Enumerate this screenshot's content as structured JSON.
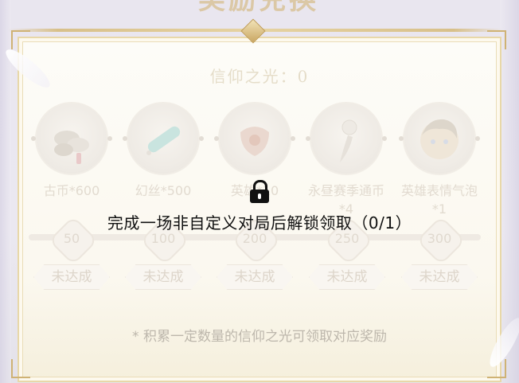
{
  "header": {
    "title": "奖励兑换"
  },
  "faith_points": {
    "label": "信仰之光：0"
  },
  "rewards": [
    {
      "name": "古币*600",
      "icon": "ancient-coins-icon"
    },
    {
      "name": "幻丝*500",
      "icon": "silk-spool-icon"
    },
    {
      "name": "英雄*10",
      "icon": "hero-mask-icon"
    },
    {
      "name": "永昼赛季通币*4",
      "icon": "season-coin-feather-icon"
    },
    {
      "name": "英雄表情气泡*1",
      "icon": "hero-emote-portrait-icon"
    }
  ],
  "milestones": [
    "50",
    "100",
    "200",
    "250",
    "300"
  ],
  "progress": {
    "current": 0,
    "max": 300
  },
  "claim_buttons": [
    "未达成",
    "未达成",
    "未达成",
    "未达成",
    "未达成"
  ],
  "lock_overlay": {
    "icon": "lock-icon",
    "text": "完成一场非自定义对局后解锁领取（0/1）"
  },
  "footnote": "* 积累一定数量的信仰之光可领取对应奖励",
  "colors": {
    "frame_gold": "#d8c08a",
    "locked_text": "#e0d9cf",
    "overlay_text": "#111111"
  }
}
